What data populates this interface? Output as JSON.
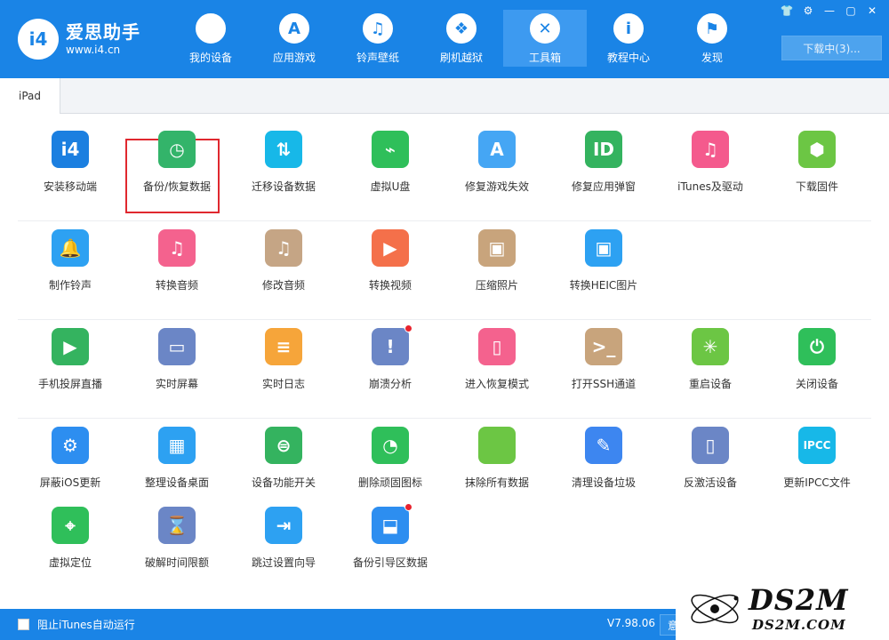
{
  "app": {
    "logo_mark": "i4",
    "title": "爱思助手",
    "url": "www.i4.cn"
  },
  "nav": [
    {
      "label": "我的设备",
      "icon": "apple-icon",
      "glyph": "",
      "active": false
    },
    {
      "label": "应用游戏",
      "icon": "app-store-icon",
      "glyph": "A",
      "active": false
    },
    {
      "label": "铃声壁纸",
      "icon": "ringtone-icon",
      "glyph": "♫",
      "active": false
    },
    {
      "label": "刷机越狱",
      "icon": "dropbox-icon",
      "glyph": "❖",
      "active": false
    },
    {
      "label": "工具箱",
      "icon": "toolbox-icon",
      "glyph": "✕",
      "active": true
    },
    {
      "label": "教程中心",
      "icon": "info-icon",
      "glyph": "i",
      "active": false
    },
    {
      "label": "发现",
      "icon": "flag-icon",
      "glyph": "⚑",
      "active": false
    }
  ],
  "download_button": "下载中(3)...",
  "window_controls": [
    "shirt-icon",
    "gear-icon",
    "minimize-icon",
    "maximize-icon",
    "close-icon"
  ],
  "tabs": [
    {
      "label": "iPad"
    }
  ],
  "tools": [
    {
      "label": "安装移动端",
      "icon": "i4-app-icon",
      "color": "#1b7fe0",
      "glyph": "i4",
      "badge": false
    },
    {
      "label": "备份/恢复数据",
      "icon": "backup-restore-icon",
      "color": "#33b46a",
      "glyph": "◷",
      "badge": false
    },
    {
      "label": "迁移设备数据",
      "icon": "migrate-data-icon",
      "color": "#17b8e8",
      "glyph": "⇅",
      "badge": false
    },
    {
      "label": "虚拟U盘",
      "icon": "usb-icon",
      "color": "#2fbf5a",
      "glyph": "⌁",
      "badge": false
    },
    {
      "label": "修复游戏失效",
      "icon": "repair-game-icon",
      "color": "#45a6f4",
      "glyph": "A",
      "badge": false
    },
    {
      "label": "修复应用弹窗",
      "icon": "apple-id-icon",
      "color": "#34b35f",
      "glyph": "ID",
      "badge": false
    },
    {
      "label": "iTunes及驱动",
      "icon": "itunes-icon",
      "color": "#f45a8d",
      "glyph": "♫",
      "badge": false
    },
    {
      "label": "下载固件",
      "icon": "firmware-cube-icon",
      "color": "#6cc644",
      "glyph": "⬢",
      "badge": false
    },
    {
      "label": "制作铃声",
      "icon": "bell-icon",
      "color": "#2da1f2",
      "glyph": "🔔",
      "badge": false
    },
    {
      "label": "转换音频",
      "icon": "convert-audio-icon",
      "color": "#f4628e",
      "glyph": "♫",
      "badge": false
    },
    {
      "label": "修改音频",
      "icon": "edit-audio-icon",
      "color": "#c5a585",
      "glyph": "♫",
      "badge": false
    },
    {
      "label": "转换视频",
      "icon": "convert-video-icon",
      "color": "#f4704a",
      "glyph": "▶",
      "badge": false
    },
    {
      "label": "压缩照片",
      "icon": "compress-photo-icon",
      "color": "#c8a47c",
      "glyph": "▣",
      "badge": false
    },
    {
      "label": "转换HEIC图片",
      "icon": "heic-icon",
      "color": "#2da1f2",
      "glyph": "▣",
      "badge": false
    },
    {
      "label": "手机投屏直播",
      "icon": "screen-cast-icon",
      "color": "#34b35f",
      "glyph": "▶",
      "badge": false
    },
    {
      "label": "实时屏幕",
      "icon": "monitor-icon",
      "color": "#6b86c6",
      "glyph": "▭",
      "badge": false
    },
    {
      "label": "实时日志",
      "icon": "log-icon",
      "color": "#f6a53a",
      "glyph": "≡",
      "badge": false
    },
    {
      "label": "崩溃分析",
      "icon": "crash-analysis-icon",
      "color": "#6b86c6",
      "glyph": "!",
      "badge": true
    },
    {
      "label": "进入恢复模式",
      "icon": "recovery-mode-icon",
      "color": "#f4628e",
      "glyph": "▯",
      "badge": false
    },
    {
      "label": "打开SSH通道",
      "icon": "ssh-terminal-icon",
      "color": "#c8a47c",
      "glyph": ">_",
      "badge": false
    },
    {
      "label": "重启设备",
      "icon": "restart-icon",
      "color": "#6cc644",
      "glyph": "✳",
      "badge": false
    },
    {
      "label": "关闭设备",
      "icon": "power-icon",
      "color": "#2fbf5a",
      "glyph": "⏻",
      "badge": false
    },
    {
      "label": "屏蔽iOS更新",
      "icon": "block-update-icon",
      "color": "#2d8ef0",
      "glyph": "⚙",
      "badge": false
    },
    {
      "label": "整理设备桌面",
      "icon": "desktop-grid-icon",
      "color": "#2da1f2",
      "glyph": "▦",
      "badge": false
    },
    {
      "label": "设备功能开关",
      "icon": "toggle-switch-icon",
      "color": "#34b35f",
      "glyph": "⊜",
      "badge": false
    },
    {
      "label": "删除顽固图标",
      "icon": "pie-delete-icon",
      "color": "#2fbf5a",
      "glyph": "◔",
      "badge": false
    },
    {
      "label": "抹除所有数据",
      "icon": "erase-apple-icon",
      "color": "#6cc644",
      "glyph": "",
      "badge": false
    },
    {
      "label": "清理设备垃圾",
      "icon": "broom-icon",
      "color": "#3d86f0",
      "glyph": "✎",
      "badge": false
    },
    {
      "label": "反激活设备",
      "icon": "deactivate-icon",
      "color": "#6b86c6",
      "glyph": "▯",
      "badge": false
    },
    {
      "label": "更新IPCC文件",
      "icon": "ipcc-icon",
      "color": "#17b8e8",
      "glyph": "IPCC",
      "badge": false
    },
    {
      "label": "虚拟定位",
      "icon": "location-pin-icon",
      "color": "#2fbf5a",
      "glyph": "⌖",
      "badge": false
    },
    {
      "label": "破解时间限额",
      "icon": "hourglass-icon",
      "color": "#6b86c6",
      "glyph": "⌛",
      "badge": false
    },
    {
      "label": "跳过设置向导",
      "icon": "skip-wizard-icon",
      "color": "#2da1f2",
      "glyph": "⇥",
      "badge": false
    },
    {
      "label": "备份引导区数据",
      "icon": "backup-boot-icon",
      "color": "#2d8ef0",
      "glyph": "⬓",
      "badge": true
    }
  ],
  "footer": {
    "checkbox_label": "阻止iTunes自动运行",
    "version": "V7.98.06",
    "feedback": "意"
  },
  "watermark": {
    "big": "DS2M",
    "small": "DS2M.COM"
  }
}
